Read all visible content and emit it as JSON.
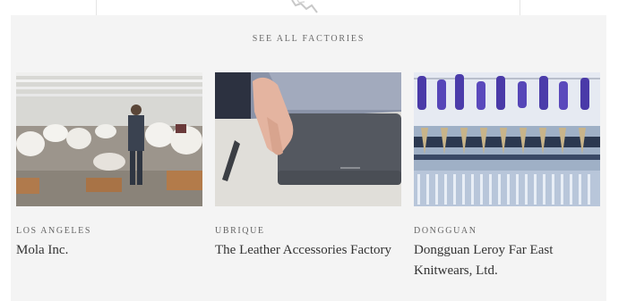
{
  "header": {
    "see_all_label": "SEE ALL FACTORIES"
  },
  "factories": [
    {
      "city": "LOS ANGELES",
      "name": "Mola Inc.",
      "photo": "garment-factory-photo"
    },
    {
      "city": "UBRIQUE",
      "name": "The Leather Accessories Factory",
      "photo": "leather-laptop-sleeve-photo"
    },
    {
      "city": "DONGGUAN",
      "name": "Dongguan Leroy Far East Knitwears, Ltd.",
      "photo": "knitting-machine-photo"
    }
  ],
  "colors": {
    "panel_bg": "#f4f4f4",
    "text_dark": "#333333",
    "text_muted": "#666666"
  }
}
